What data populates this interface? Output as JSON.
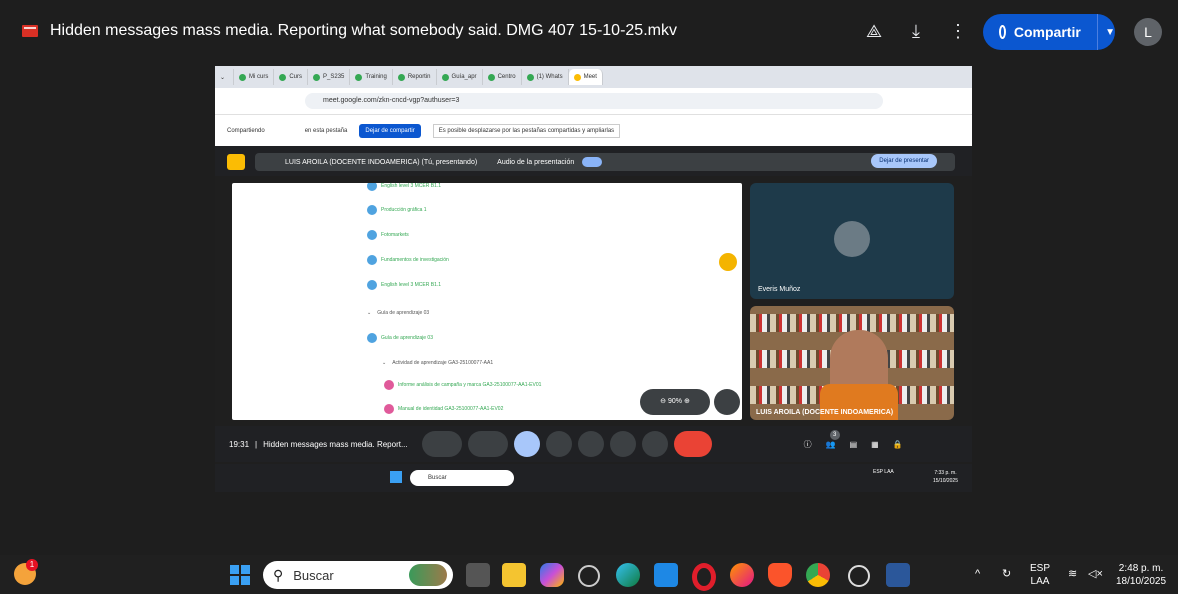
{
  "header": {
    "file_title": "Hidden messages mass media. Reporting what somebody said. DMG 407 15-10-25.mkv",
    "share_label": "Compartir",
    "avatar_letter": "L"
  },
  "video": {
    "tabs": [
      "Mi curs",
      "Curs",
      "P_S235",
      "Training",
      "Reportin",
      "Guía_apr",
      "Centro",
      "(1) Whats",
      "Meet"
    ],
    "url": "meet.google.com/zkn-cncd-vgp?authuser=3",
    "sharing_prefix": "Compartiendo",
    "sharing_suffix": "en esta pestaña",
    "stop_sharing": "Dejar de compartir",
    "scroll_hint": "Es posible desplazarse por las pestañas compartidas y ampliarlas",
    "presenter": "LUIS AROILA (DOCENTE INDOAMERICA) (Tú, presentando)",
    "audio_label": "Audio de la presentación",
    "stop_presenting": "Dejar de presentar",
    "doc_lines": [
      "English level 3 MCER B1.1",
      "Producción gráfica 1",
      "Fotomarkets",
      "Fundamentos de investigación",
      "English level 3 MCER B1.1",
      "Guía de aprendizaje 03",
      "Guía de aprendizaje 03",
      "Actividad de aprendizaje GA3-25100077-AA1",
      "Informe análisis de campaña y marca GA3-25100077-AA1-EV01",
      "Manual de identidad GA3-25100077-AA1-EV02"
    ],
    "zoom": "90%",
    "participant1": "Everis Muñoz",
    "participant2": "LUIS AROILA (DOCENTE INDOAMERICA)",
    "participant_count": "3",
    "meeting_time": "19:31",
    "meeting_name": "Hidden messages mass media. Report...",
    "inner_search": "Buscar",
    "inner_lang": "ESP LAA",
    "inner_time": "7:33 p. m.",
    "inner_date": "15/10/2025"
  },
  "taskbar": {
    "notification_count": "1",
    "search_placeholder": "Buscar",
    "lang_top": "ESP",
    "lang_bottom": "LAA",
    "time": "2:48 p. m.",
    "date": "18/10/2025",
    "apps": [
      "file-explorer-icon",
      "folder-icon",
      "copilot-icon",
      "speedometer-icon",
      "edge-icon",
      "store-icon",
      "opera-icon",
      "firefox-icon",
      "brave-icon",
      "chrome-icon",
      "chatgpt-icon",
      "word-icon"
    ]
  }
}
